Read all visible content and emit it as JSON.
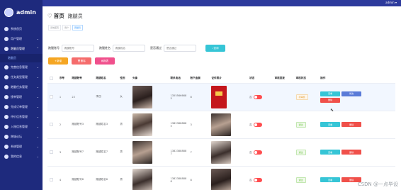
{
  "topbar": {
    "user": "admin"
  },
  "sidebar": {
    "admin_name": "admin",
    "items": [
      {
        "label": "系统首页",
        "icon": "home-icon"
      },
      {
        "label": "用户管理",
        "icon": "user-icon",
        "arrow": "⌄"
      },
      {
        "label": "跑腿员管理",
        "icon": "runner-icon",
        "arrow": "⌃",
        "open": true
      },
      {
        "label": "跑腿员",
        "sub": true
      },
      {
        "label": "完善信息管理",
        "icon": "info-icon",
        "arrow": "⌄"
      },
      {
        "label": "任务类型管理",
        "icon": "type-icon",
        "arrow": "⌄"
      },
      {
        "label": "跑腿任务管理",
        "icon": "task-icon",
        "arrow": "⌄"
      },
      {
        "label": "接单管理",
        "icon": "order-icon",
        "arrow": "⌄"
      },
      {
        "label": "完成订单管理",
        "icon": "done-icon",
        "arrow": "⌄"
      },
      {
        "label": "评价信息管理",
        "icon": "comment-icon",
        "arrow": "⌄"
      },
      {
        "label": "入账信息管理",
        "icon": "money-icon",
        "arrow": "⌄"
      },
      {
        "label": "跨城论坛",
        "icon": "forum-icon",
        "arrow": "⌄"
      },
      {
        "label": "系统管理",
        "icon": "settings-icon",
        "arrow": "⌄"
      },
      {
        "label": "我的信息",
        "icon": "profile-icon",
        "arrow": "⌄"
      }
    ]
  },
  "page": {
    "title": "首页",
    "subtitle": "跑腿员",
    "tabs": [
      "系统首页",
      "用户",
      "跑腿员"
    ]
  },
  "search": {
    "f1_label": "跑腿账号",
    "f1_placeholder": "跑腿账号",
    "f2_label": "跑腿姓名",
    "f2_placeholder": "跑腿姓名",
    "f3_label": "是否通过",
    "f3_placeholder": "是否通过",
    "button": "查询"
  },
  "actions": {
    "add": "新增",
    "delete": "删除",
    "report": "报表"
  },
  "table": {
    "headers": [
      "",
      "序号",
      "跑腿账号",
      "跑腿姓名",
      "性别",
      "头像",
      "联系电话",
      "账户金额",
      "证件照片",
      "状态",
      "审核回复",
      "审核状态",
      "操作"
    ],
    "rows": [
      {
        "no": "1",
        "account": "22",
        "name": "李四",
        "gender": "女",
        "phone": "13555666685",
        "balance": "8",
        "status_text": "否",
        "audit": "待审核",
        "audit_type": "pending"
      },
      {
        "no": "2",
        "account": "跑腿账号3",
        "name": "跑腿姓名3",
        "gender": "男",
        "phone": "13823888885",
        "balance": "3",
        "status_text": "否",
        "audit": "通过",
        "audit_type": "pass"
      },
      {
        "no": "3",
        "account": "跑腿账号7",
        "name": "跑腿姓名7",
        "gender": "男",
        "phone": "13823888887",
        "balance": "7",
        "status_text": "否",
        "audit": "通过",
        "audit_type": "pass"
      },
      {
        "no": "4",
        "account": "跑腿账号8",
        "name": "跑腿姓名8",
        "gender": "男",
        "phone": "13823888888",
        "balance": "8",
        "status_text": "否",
        "audit": "通过",
        "audit_type": "pass"
      }
    ],
    "op_view": "查看",
    "op_edit": "修改",
    "op_delete": "删除"
  },
  "watermark": "CSDN @一点毕设"
}
